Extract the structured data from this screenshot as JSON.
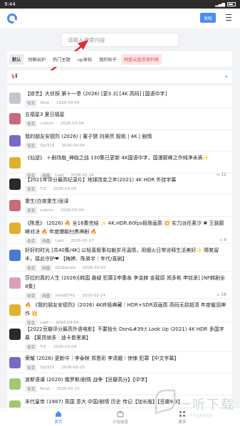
{
  "status_bar": {
    "time": "9:44"
  },
  "header": {
    "post_label": "发帖"
  },
  "search": {
    "placeholder": "请输入搜索内容"
  },
  "tabs": [
    {
      "label": "默认"
    },
    {
      "label": "别解出炉"
    },
    {
      "label": "热门主题"
    },
    {
      "label": "up发帖"
    },
    {
      "label": "我的帖子"
    },
    {
      "label": "网盘云盘资源列表"
    }
  ],
  "colors": {
    "accent": "#4a8cf0",
    "hot_tab": "#e05050",
    "annotation_arrow": "#e03030"
  },
  "posts": [
    {
      "title": "【综艺】大侦探 第十一季 (2026) [更3.3] [4K 高码] [国语中字]",
      "tag": "夸克",
      "user": "Yone",
      "date": "2026-03-04",
      "avatar": "#bfc6d0"
    },
    {
      "title": "五福星3 夏日福星",
      "tag": "夸克",
      "user": "cvbnm",
      "date": "2026-03-04",
      "avatar": "#c86a7a"
    },
    {
      "title": "我的朋友安德烈 (2026) | 董子健 刘昊然 殷桃 | 4K | 剧情",
      "tag": "夸克",
      "user": "Qyf315",
      "date": "2026-03-04",
      "avatar": "#7a68c8"
    },
    {
      "title": "《仙逆》 ＋剧场版_神临之战 130集已更新 4K国语中字，国漫巅峰之作纯净未表✨",
      "tag": "夸克",
      "extra": "网盘",
      "user": "Laot",
      "date": "2026-02-24",
      "avatar": "#e0b030",
      "count": "12"
    },
    {
      "title": "【2021年评分最高纪录片】地球改变之年(2021) 4K HDR 外挂字幕",
      "tag": "夸克",
      "user": "T-Z",
      "date": "2026-03-04",
      "avatar": "#2a2a2a"
    },
    {
      "title": "重生(白夜重生)张译",
      "tag": "夸克",
      "user": "cvbnm",
      "date": "2026-03-04",
      "avatar": "#c86a7a"
    },
    {
      "title": "《陈思》 (2026) 🔥 全16集完结 ✨ 4K.HDR.60fps极致画质 💥 实力派任素汐 ✖ 王骁巅峰对决 🔥 年度爆款扫黑神剧 🔥",
      "tag": "夸克",
      "extra": "网盘",
      "user": "Laot",
      "date": "2026-02-27",
      "avatar": "#e0b030",
      "count": "4"
    },
    {
      "title": "好好的时光 [共40集/4K] 以轻喜叙事勾勒岁月温情，用烟火日常诠释生活美好✨ 晴笑留丰，接此守护❤ 【梅婷、陈昊宇｜年代/喜剧】",
      "tag": "夸克",
      "extra": "网盘",
      "user": "GZdianala",
      "date": "2026-03-02",
      "avatar": "#4a7ad0"
    },
    {
      "title": "莎拉的真的人生 (2026)[韩国 悬疑 犯罪][申惠善 李浚赫 金载原 郑多彬 申铉承] [NF韩剧全8集]",
      "tag": "夸克",
      "extra": "网盘",
      "user": "min00741",
      "date": "2026-02-14",
      "avatar": "#d8a0b8",
      "count": "16"
    },
    {
      "title": "🔥 《我的朋友安德烈》(2026) 4K终极典藏｜HDR+SDR双画质 高码无损超清 年度催泪神作 💥",
      "tag": "夸克",
      "user": "Laot",
      "date": "2026-03-03",
      "avatar": "#e0b030"
    },
    {
      "title": "【2022豆瓣评分最高外语电影】不要抬头 Don&#39;t Look Up (2021) 4K HDR 多国字幕 【莱昂纳多 · 迪卡普里奥】",
      "tag": "夸克",
      "user": "T-Z",
      "date": "2026-03-04",
      "avatar": "#2a2a2a"
    },
    {
      "title": "荣耀 (2026) 更新中｜李泰映 郑恩彩 李清娥｜惊悚 犯罪【中文字幕】",
      "tag": "夸克",
      "user": "Qyf315",
      "date": "2026-02-25",
      "avatar": "#7a68c8"
    },
    {
      "title": "波斯语课 (2020) 俄罗斯/剧情 战争【豆瓣高分】【中字】",
      "tag": "夸克",
      "user": "fecal",
      "date": "2026-01-22",
      "avatar": "#a0c870"
    },
    {
      "title": "末代皇帝 (1987) 英国 意大 中国/剧情 历史 传记【加长版】【豆瓣9.3】",
      "tag": "",
      "user": "",
      "date": "",
      "avatar": "#a0c870"
    }
  ],
  "bottom_nav": [
    {
      "label": "首页",
      "icon": "home-icon"
    },
    {
      "label": "小站信息",
      "icon": "briefcase-icon"
    },
    {
      "label": "更多",
      "icon": "grid-icon"
    }
  ],
  "watermark": {
    "main": "一听下载",
    "sub": "ITingXiaZai"
  }
}
